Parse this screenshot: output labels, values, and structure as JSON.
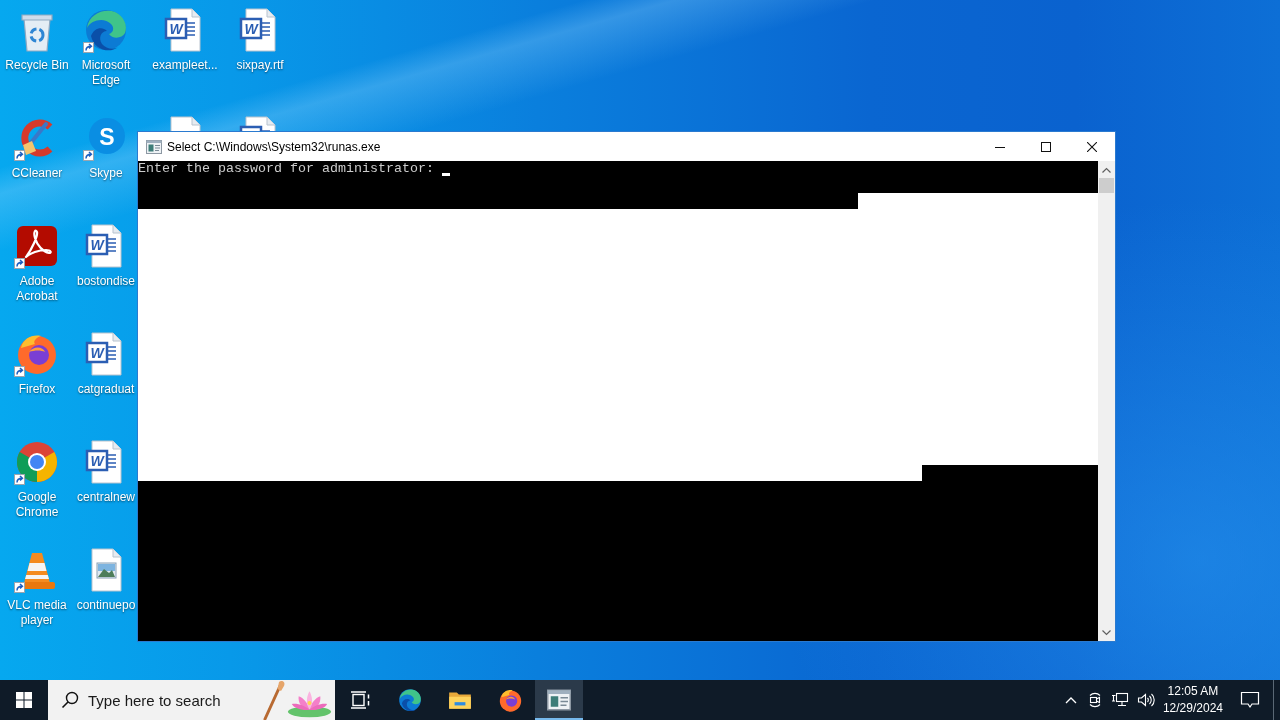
{
  "desktop": {
    "columns": [
      [
        {
          "kind": "recycle-bin",
          "label": "Recycle Bin",
          "shortcut": false
        },
        {
          "kind": "ccleaner",
          "label": "CCleaner",
          "shortcut": true
        },
        {
          "kind": "acrobat",
          "label": "Adobe Acrobat",
          "shortcut": true
        },
        {
          "kind": "firefox",
          "label": "Firefox",
          "shortcut": true
        },
        {
          "kind": "chrome",
          "label": "Google Chrome",
          "shortcut": true
        },
        {
          "kind": "vlc",
          "label": "VLC media player",
          "shortcut": true
        }
      ],
      [
        {
          "kind": "edge",
          "label": "Microsoft Edge",
          "shortcut": true
        },
        {
          "kind": "skype",
          "glyph": "S",
          "label": "Skype",
          "shortcut": true
        },
        {
          "kind": "word",
          "glyph": "W",
          "label": "bostondise",
          "shortcut": false
        },
        {
          "kind": "word",
          "glyph": "W",
          "label": "catgraduat",
          "shortcut": false
        },
        {
          "kind": "word",
          "glyph": "W",
          "label": "centralnew",
          "shortcut": false
        },
        {
          "kind": "image-file",
          "label": "continuepo",
          "shortcut": false
        }
      ],
      [
        {
          "kind": "word",
          "glyph": "W",
          "label": "exampleet...",
          "shortcut": false
        },
        {
          "kind": "file"
        }
      ],
      [
        {
          "kind": "word",
          "glyph": "W",
          "label": "sixpay.rtf",
          "shortcut": false
        },
        {
          "kind": "word"
        }
      ]
    ]
  },
  "window": {
    "title": "Select C:\\Windows\\System32\\runas.exe",
    "console": {
      "rows": [
        {
          "text": "Enter the password for administrator: ",
          "cursor": true,
          "selected": false
        },
        {
          "selected": false
        },
        {
          "selected": true,
          "level": 0.25
        },
        {
          "selected": true
        },
        {
          "selected": true
        },
        {
          "selected": true
        },
        {
          "selected": true
        },
        {
          "selected": true
        },
        {
          "selected": true
        },
        {
          "selected": true
        },
        {
          "selected": true
        },
        {
          "selected": true
        },
        {
          "selected": true
        },
        {
          "selected": true
        },
        {
          "selected": true
        },
        {
          "selected": true
        },
        {
          "selected": true
        },
        {
          "selected": true
        },
        {
          "selected": true
        },
        {
          "selected": true,
          "level": 0.8167
        },
        {
          "selected": false
        },
        {
          "selected": false
        },
        {
          "selected": false
        },
        {
          "selected": false
        },
        {
          "selected": false
        },
        {
          "selected": false
        },
        {
          "selected": false
        },
        {
          "selected": false
        },
        {
          "selected": false
        },
        {
          "selected": false
        }
      ]
    }
  },
  "taskbar": {
    "search": {
      "placeholder": "Type here to search"
    },
    "apps": [
      {
        "kind": "edge",
        "selected": false
      },
      {
        "kind": "file-explorer",
        "selected": false
      },
      {
        "kind": "firefox",
        "selected": false
      },
      {
        "kind": "console",
        "selected": true
      }
    ],
    "tray": {
      "time": "12:05 AM",
      "date": "12/29/2024"
    }
  }
}
